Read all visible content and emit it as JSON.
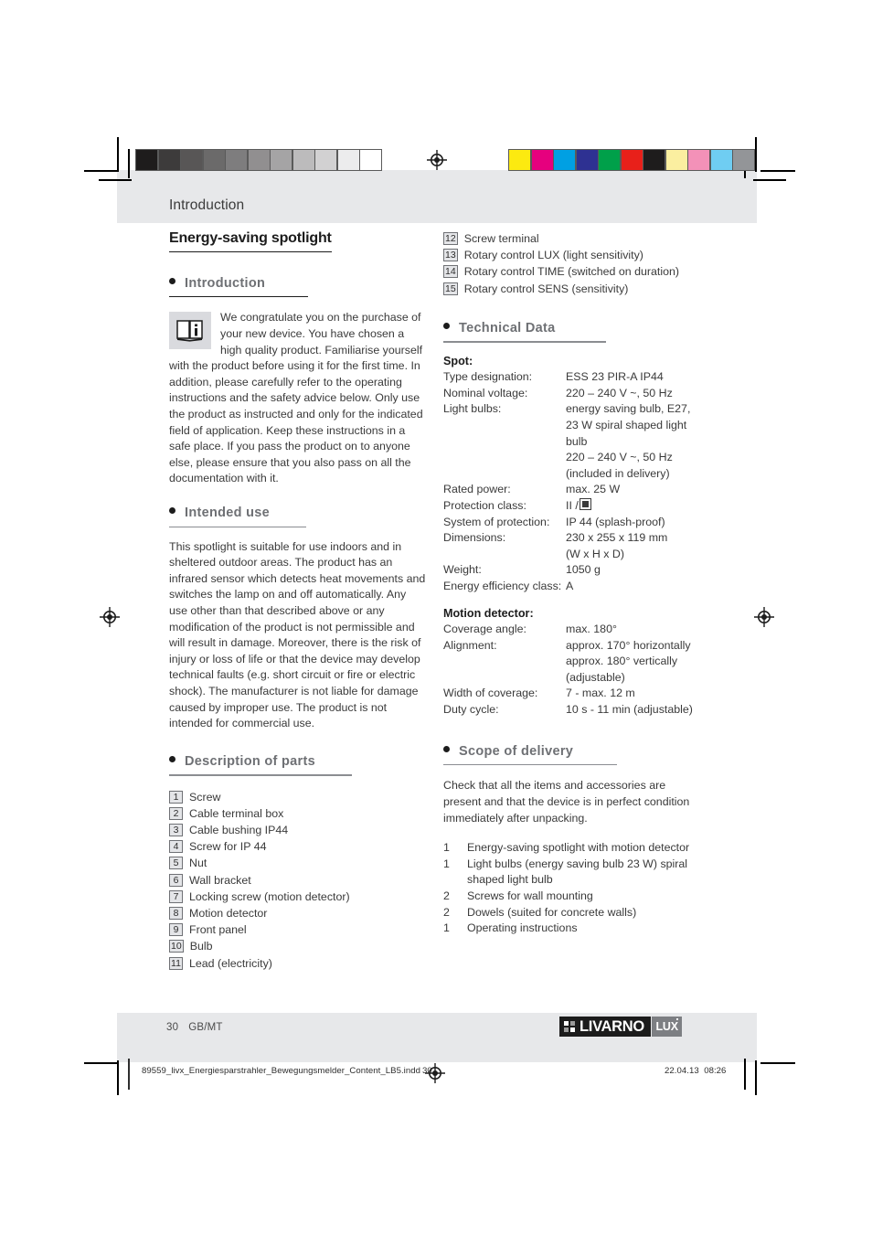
{
  "page": {
    "running_head": "Introduction",
    "title": "Energy-saving spotlight",
    "folio_number": "30",
    "folio_locale": "GB/MT"
  },
  "calibration": {
    "gray_scale": [
      "#1e1c1c",
      "#3d3b3b",
      "#585656",
      "#6b6a6a",
      "#7e7d7e",
      "#918f90",
      "#a5a4a5",
      "#bcbbbc",
      "#d2d1d2",
      "#ececed",
      "#ffffff"
    ],
    "color_bars": [
      "#fcea10",
      "#e6007e",
      "#00a0e3",
      "#2e3192",
      "#00a04a",
      "#e8201a",
      "#1e1c1c",
      "#fbefa0",
      "#f391b8",
      "#6fcdf2",
      "#939598"
    ]
  },
  "left_column": {
    "intro": {
      "heading": "Introduction",
      "icon": "info-book-icon",
      "paragraph": "We congratulate you on the purchase of your new device. You have chosen a high quality product. Familiarise yourself with the product before using it for the first time. In addition, please carefully refer to the operating instructions and the safety advice below. Only use the product as instructed and only for the indicated field of application. Keep these instructions in a safe place. If you pass the product on to anyone else, please ensure that you also pass on all the documentation with it."
    },
    "intended_use": {
      "heading": "Intended use",
      "paragraph": "This spotlight is suitable for use indoors and in sheltered outdoor areas. The product has an infrared sensor which detects heat movements and switches the lamp on and off automatically. Any use other than that described above or any modification of the product is not permissible and will result in damage. Moreover, there is the risk of injury or loss of life or that the device may develop technical faults (e.g. short circuit or fire or electric shock). The manufacturer is not liable for damage caused by improper use. The product is not intended for commercial use."
    },
    "description_of_parts": {
      "heading": "Description of parts",
      "items": [
        {
          "num": "1",
          "label": "Screw"
        },
        {
          "num": "2",
          "label": "Cable terminal box"
        },
        {
          "num": "3",
          "label": "Cable bushing IP44"
        },
        {
          "num": "4",
          "label": "Screw for IP 44"
        },
        {
          "num": "5",
          "label": "Nut"
        },
        {
          "num": "6",
          "label": "Wall bracket"
        },
        {
          "num": "7",
          "label": "Locking screw (motion detector)"
        },
        {
          "num": "8",
          "label": "Motion detector"
        },
        {
          "num": "9",
          "label": "Front panel"
        },
        {
          "num": "10",
          "label": "Bulb"
        },
        {
          "num": "11",
          "label": "Lead (electricity)"
        }
      ]
    }
  },
  "right_column": {
    "parts_continued": [
      {
        "num": "12",
        "label": "Screw terminal"
      },
      {
        "num": "13",
        "label": "Rotary control LUX (light sensitivity)"
      },
      {
        "num": "14",
        "label": "Rotary control TIME (switched on duration)"
      },
      {
        "num": "15",
        "label": "Rotary control SENS (sensitivity)"
      }
    ],
    "technical_data": {
      "heading": "Technical Data",
      "spot_title": "Spot:",
      "spot_rows": [
        {
          "key": "Type designation:",
          "value": "ESS 23 PIR-A IP44"
        },
        {
          "key": "Nominal voltage:",
          "value": "220 – 240 V ~, 50 Hz"
        },
        {
          "key": "Light bulbs:",
          "value": "energy saving bulb, E27,"
        },
        {
          "key": "",
          "value": "23 W spiral shaped light"
        },
        {
          "key": "",
          "value": "bulb"
        },
        {
          "key": "",
          "value": "220 – 240 V ~, 50 Hz"
        },
        {
          "key": "",
          "value": "(included in delivery)"
        },
        {
          "key": "Rated power:",
          "value": "max. 25 W"
        },
        {
          "key": "Protection class:",
          "value": "II /",
          "symbol": "class-II-double-insulation"
        },
        {
          "key": "System of protection:",
          "value": "IP 44 (splash-proof)"
        },
        {
          "key": "Dimensions:",
          "value": "230 x 255 x 119 mm"
        },
        {
          "key": "",
          "value": "(W x H x D)"
        },
        {
          "key": "Weight:",
          "value": "1050 g"
        },
        {
          "key": "Energy efficiency class:",
          "value": "A"
        }
      ],
      "motion_title": "Motion detector:",
      "motion_rows": [
        {
          "key": "Coverage angle:",
          "value": "max. 180°"
        },
        {
          "key": "Alignment:",
          "value": "approx. 170° horizontally"
        },
        {
          "key": "",
          "value": "approx. 180° vertically"
        },
        {
          "key": "",
          "value": "(adjustable)"
        },
        {
          "key": "Width of coverage:",
          "value": "7 - max. 12 m"
        },
        {
          "key": "Duty cycle:",
          "value": "10 s - 11 min (adjustable)"
        }
      ]
    },
    "scope_of_delivery": {
      "heading": "Scope of delivery",
      "paragraph": "Check that all the items and accessories are present and that the device is in perfect condition immediately after unpacking.",
      "items": [
        {
          "qty": "1",
          "label": "Energy-saving spotlight with motion detector"
        },
        {
          "qty": "1",
          "label": "Light bulbs (energy saving bulb 23 W) spiral"
        },
        {
          "qty": "",
          "label": "shaped light bulb"
        },
        {
          "qty": "2",
          "label": "Screws for wall mounting"
        },
        {
          "qty": "2",
          "label": "Dowels (suited for concrete walls)"
        },
        {
          "qty": "1",
          "label": "Operating instructions"
        }
      ]
    }
  },
  "logo": {
    "word": "LIVARNO",
    "suffix": "LUX"
  },
  "imprint": {
    "filename": "89559_livx_Energiesparstrahler_Bewegungsmelder_Content_LB5.indd",
    "folio": "30",
    "date": "22.04.13",
    "time": "08:26"
  }
}
